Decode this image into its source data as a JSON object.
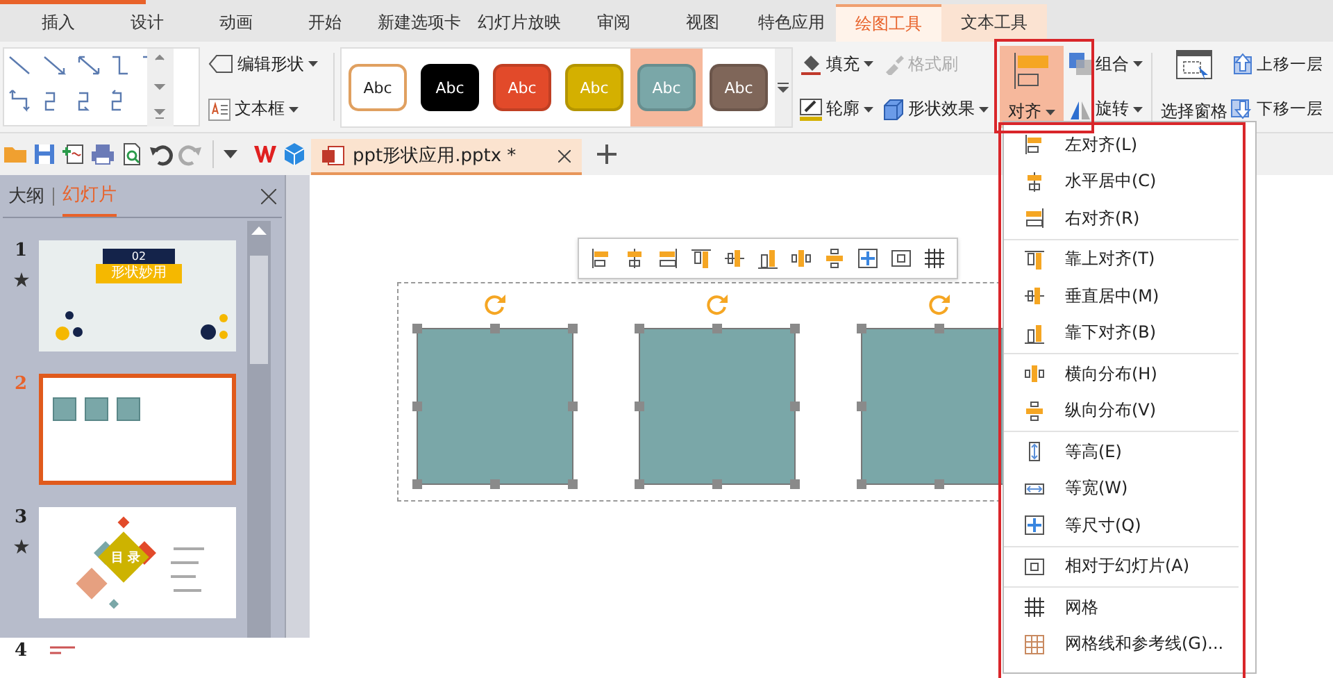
{
  "tabs": [
    {
      "label": "插入",
      "selected": false,
      "contextual": false
    },
    {
      "label": "设计",
      "selected": false,
      "contextual": false
    },
    {
      "label": "动画",
      "selected": false,
      "contextual": false
    },
    {
      "label": "开始",
      "selected": false,
      "contextual": false
    },
    {
      "label": "新建选项卡",
      "selected": false,
      "contextual": false
    },
    {
      "label": "幻灯片放映",
      "selected": false,
      "contextual": false
    },
    {
      "label": "审阅",
      "selected": false,
      "contextual": false
    },
    {
      "label": "视图",
      "selected": false,
      "contextual": false
    },
    {
      "label": "特色应用",
      "selected": false,
      "contextual": false
    },
    {
      "label": "绘图工具",
      "selected": true,
      "contextual": true
    },
    {
      "label": "文本工具",
      "selected": false,
      "contextual": true
    }
  ],
  "ribbon": {
    "edit_shape": "编辑形状",
    "text_box": "文本框",
    "styles": [
      {
        "label": "Abc",
        "color": "#ffffff",
        "selected": false
      },
      {
        "label": "Abc",
        "color": "#000000",
        "selected": false
      },
      {
        "label": "Abc",
        "color": "#e24a2a",
        "selected": false
      },
      {
        "label": "Abc",
        "color": "#d4b000",
        "selected": false
      },
      {
        "label": "Abc",
        "color": "#7aa7a8",
        "selected": true
      },
      {
        "label": "Abc",
        "color": "#7f6659",
        "selected": false
      }
    ],
    "fill": "填充",
    "format_painter": {
      "label": "格式刷",
      "disabled": true
    },
    "outline": "轮廓",
    "shape_effects": "形状效果",
    "align": {
      "label": "对齐",
      "expanded": true
    },
    "group": "组合",
    "rotate": "旋转",
    "selection_pane": "选择窗格",
    "bring_forward": "上移一层",
    "send_backward": "下移一层"
  },
  "documents": [
    {
      "title": "ppt形状应用.pptx *",
      "selected": true
    }
  ],
  "panel": {
    "tabs": [
      {
        "label": "大纲",
        "selected": false
      },
      {
        "label": "幻灯片",
        "selected": true
      }
    ],
    "slides": [
      {
        "number": "1",
        "selected": false,
        "starred": true,
        "kind": "title",
        "texts": [
          "02",
          "形状妙用"
        ]
      },
      {
        "number": "2",
        "selected": true,
        "starred": false,
        "kind": "squares"
      },
      {
        "number": "3",
        "selected": false,
        "starred": true,
        "kind": "contents",
        "texts": [
          "目 录"
        ]
      },
      {
        "number": "4",
        "selected": false,
        "starred": false,
        "kind": "blank"
      }
    ]
  },
  "canvas": {
    "shapes": [
      {
        "selected": true
      },
      {
        "selected": true
      },
      {
        "selected": true
      }
    ]
  },
  "align_menu": {
    "sections": [
      [
        {
          "kind": "left",
          "label": "左对齐(L)"
        },
        {
          "kind": "hcenter",
          "label": "水平居中(C)"
        },
        {
          "kind": "right",
          "label": "右对齐(R)"
        }
      ],
      [
        {
          "kind": "top",
          "label": "靠上对齐(T)"
        },
        {
          "kind": "vmiddle",
          "label": "垂直居中(M)"
        },
        {
          "kind": "bottom",
          "label": "靠下对齐(B)"
        }
      ],
      [
        {
          "kind": "hdist",
          "label": "横向分布(H)"
        },
        {
          "kind": "vdist",
          "label": "纵向分布(V)"
        }
      ],
      [
        {
          "kind": "same-height",
          "label": "等高(E)"
        },
        {
          "kind": "same-width",
          "label": "等宽(W)"
        },
        {
          "kind": "same-size",
          "label": "等尺寸(Q)"
        }
      ],
      [
        {
          "kind": "relative",
          "label": "相对于幻灯片(A)"
        }
      ],
      [
        {
          "kind": "grid",
          "label": "网格"
        },
        {
          "kind": "guides",
          "label": "网格线和参考线(G)..."
        }
      ]
    ]
  }
}
